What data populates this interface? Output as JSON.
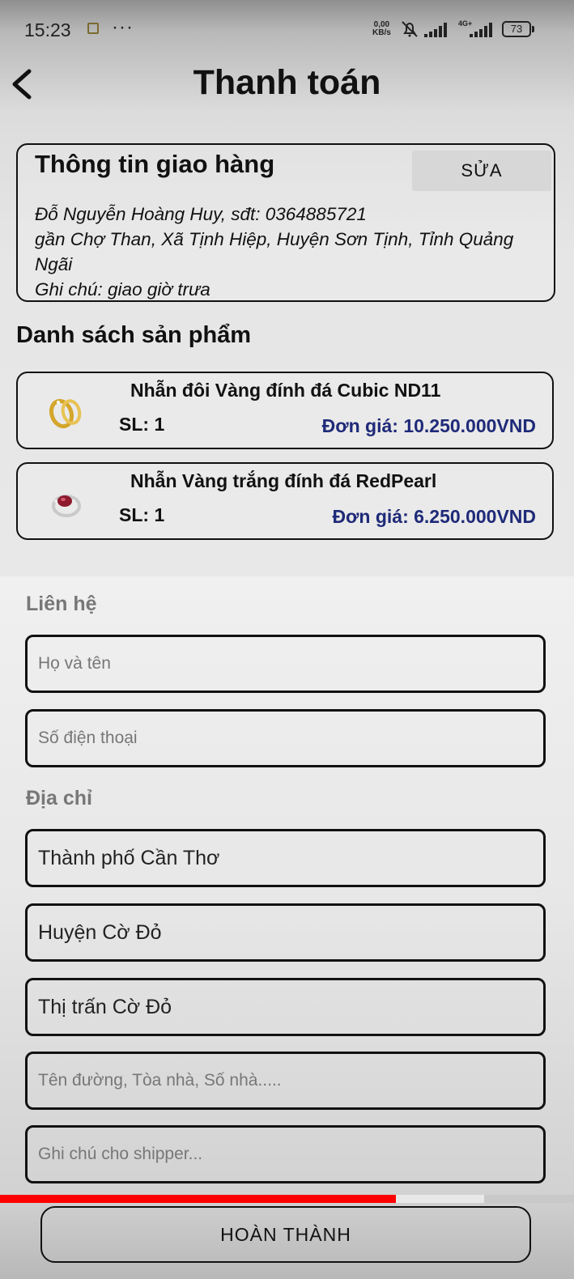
{
  "status_bar": {
    "time": "15:23",
    "dots": "···",
    "net_speed_value": "0,00",
    "net_speed_unit": "KB/s",
    "network": "4G+",
    "battery": "73"
  },
  "header": {
    "title": "Thanh toán",
    "back_icon": "chevron-left-icon"
  },
  "delivery_info": {
    "title": "Thông tin giao hàng",
    "edit_label": "SỬA",
    "lines": [
      "Đỗ Nguyễn Hoàng Huy, sđt: 0364885721",
      "gần Chợ Than, Xã Tịnh Hiệp, Huyện Sơn Tịnh, Tỉnh Quảng",
      "Ngãi",
      "Ghi chú: giao giờ trưa"
    ]
  },
  "products": {
    "title": "Danh sách sản phẩm",
    "items": [
      {
        "name": "Nhẫn đôi Vàng đính đá Cubic ND11",
        "qty": "SL: 1",
        "price": "Đơn giá: 10.250.000VND",
        "thumb": "gold-couple-rings-image"
      },
      {
        "name": "Nhẫn Vàng trắng đính đá RedPearl",
        "qty": "SL: 1",
        "price": "Đơn giá: 6.250.000VND",
        "thumb": "white-gold-ruby-ring-image"
      }
    ]
  },
  "contact": {
    "label": "Liên hệ",
    "name_placeholder": "Họ và tên",
    "phone_placeholder": "Số điện thoại"
  },
  "address": {
    "label": "Địa chỉ",
    "city": "Thành phố Cần Thơ",
    "district": "Huyện Cờ Đỏ",
    "ward": "Thị trấn Cờ Đỏ",
    "street_placeholder": "Tên đường, Tòa nhà, Số nhà.....",
    "note_placeholder": "Ghi chú cho shipper..."
  },
  "video_progress": 0.69,
  "submit_label": "HOÀN THÀNH",
  "colors": {
    "price": "#1f2a78",
    "label_gray": "#777777",
    "progress": "#ff0000"
  }
}
